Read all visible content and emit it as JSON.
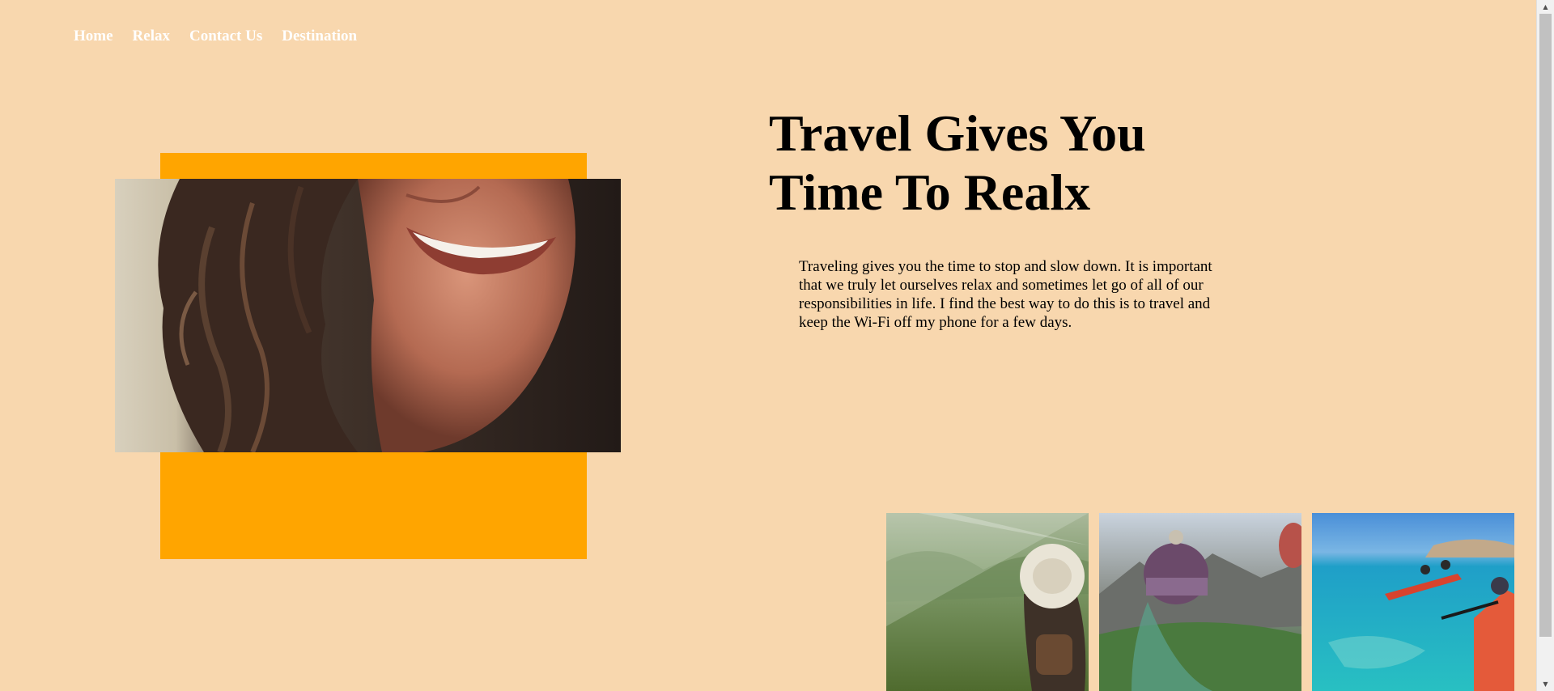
{
  "nav": {
    "items": [
      {
        "label": "Home"
      },
      {
        "label": "Relax"
      },
      {
        "label": "Contact Us"
      },
      {
        "label": "Destination"
      }
    ]
  },
  "hero": {
    "heading_line1": "Travel Gives You",
    "heading_line2": "Time To Realx",
    "paragraph": "Traveling gives you the time to stop and slow down. It is important that we truly let ourselves relax and sometimes let go of all of our responsibilities in life. I find the best way to do this is to travel and keep the Wi-Fi off my phone for a few days.",
    "accent_color": "#ffa500",
    "background_color": "#f8d7ae"
  },
  "scrollbar": {
    "up_glyph": "▲",
    "down_glyph": "▼"
  }
}
